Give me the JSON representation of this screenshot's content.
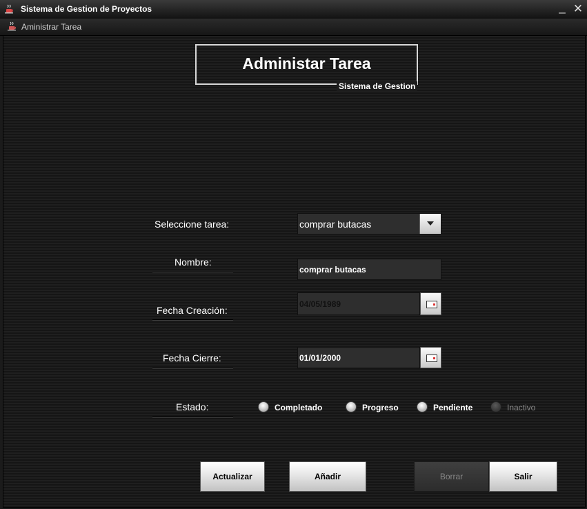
{
  "window": {
    "title": "Sistema de Gestion de Proyectos",
    "min_glyph": "_",
    "close_glyph": "✕"
  },
  "frame": {
    "title": "Aministrar Tarea"
  },
  "header": {
    "title": "Administar Tarea",
    "caption": "Sistema de Gestion"
  },
  "form": {
    "select_label": "Seleccione tarea:",
    "select_value": "comprar butacas",
    "nombre_label": "Nombre:",
    "nombre_value": "comprar butacas",
    "fecha_creacion_label": "Fecha Creación:",
    "fecha_creacion_value": "04/05/1989",
    "fecha_cierre_label": "Fecha Cierre:",
    "fecha_cierre_value": "01/01/2000",
    "estado_label": "Estado:",
    "estado_options": [
      {
        "label": "Completado",
        "enabled": true
      },
      {
        "label": "Progreso",
        "enabled": true
      },
      {
        "label": "Pendiente",
        "enabled": true
      },
      {
        "label": "Inactivo",
        "enabled": false
      }
    ]
  },
  "buttons": {
    "actualizar": "Actualizar",
    "anadir": "Añadir",
    "borrar": "Borrar",
    "salir": "Salir"
  },
  "colors": {
    "background": "#1b1b1b",
    "field": "#2e2e2e",
    "text": "#ffffff",
    "disabled_text": "#888888"
  },
  "icons": [
    "java-coffee-icon",
    "minimize-icon",
    "close-icon",
    "dropdown-arrow-icon",
    "calendar-icon"
  ]
}
